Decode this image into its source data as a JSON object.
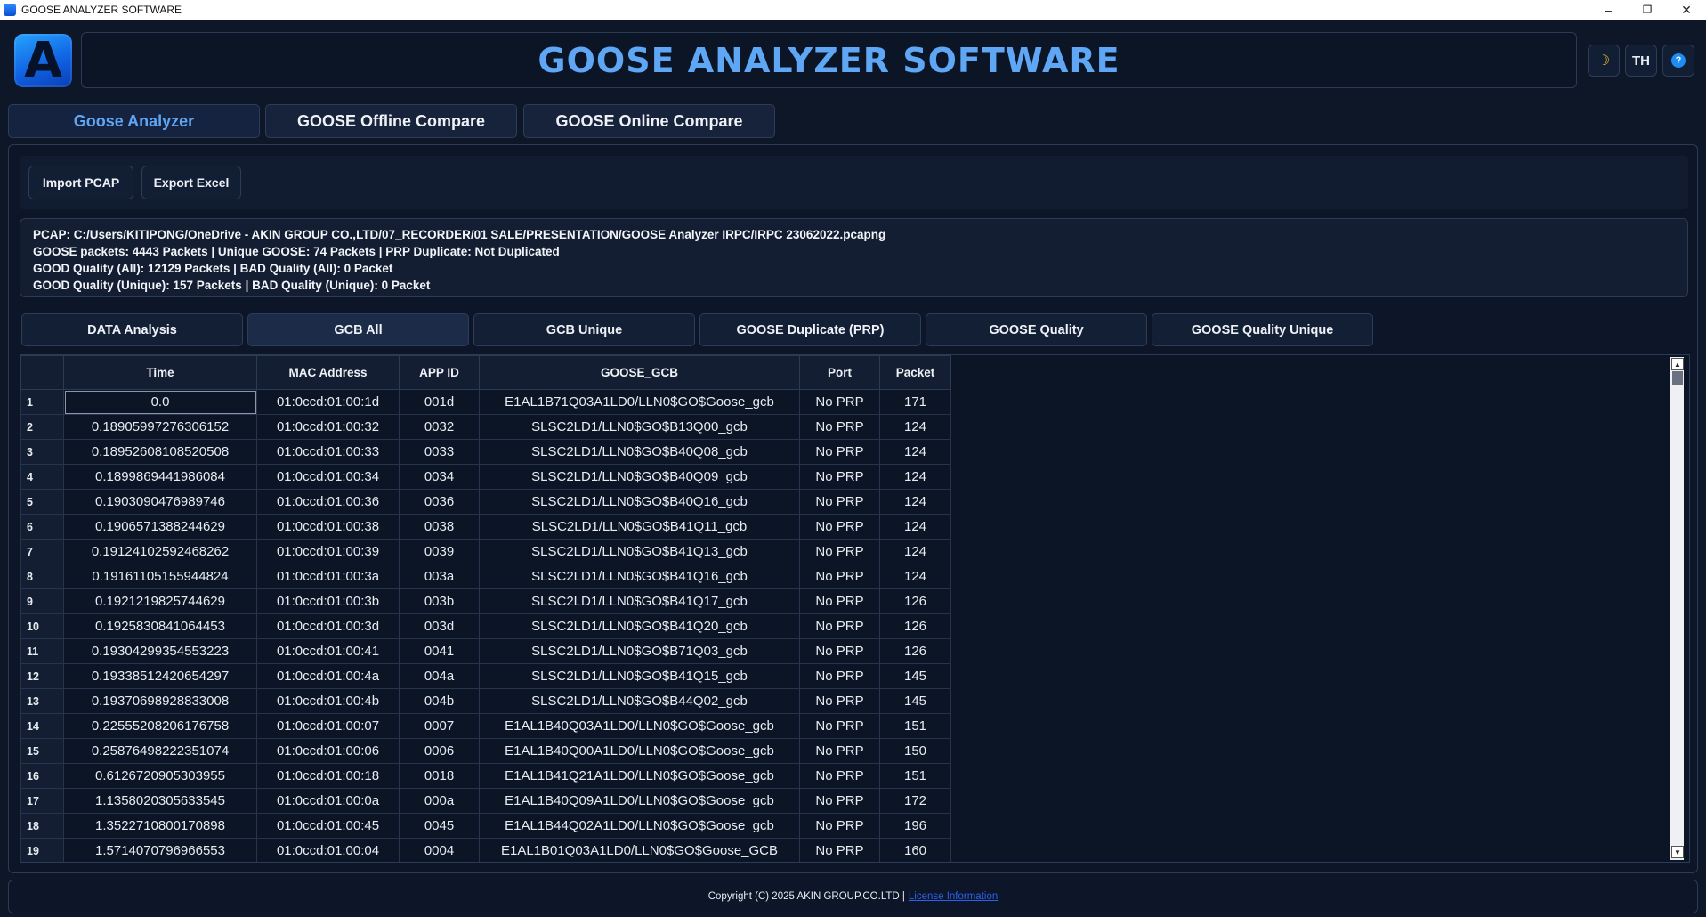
{
  "window": {
    "title": "GOOSE ANALYZER SOFTWARE",
    "minimize": "–",
    "restore": "❐",
    "close": "✕"
  },
  "header": {
    "logo_letter": "A",
    "title": "GOOSE ANALYZER SOFTWARE",
    "theme_icon": "☽",
    "lang_label": "TH",
    "help_icon": "?"
  },
  "main_tabs": [
    {
      "label": "Goose Analyzer"
    },
    {
      "label": "GOOSE Offline Compare"
    },
    {
      "label": "GOOSE Online Compare"
    }
  ],
  "toolbar": {
    "import_label": "Import PCAP",
    "export_label": "Export Excel"
  },
  "info": {
    "line1": "PCAP: C:/Users/KITIPONG/OneDrive - AKIN GROUP CO.,LTD/07_RECORDER/01 SALE/PRESENTATION/GOOSE Analyzer IRPC/IRPC 23062022.pcapng",
    "line2": "GOOSE packets: 4443 Packets | Unique GOOSE: 74 Packets | PRP Duplicate: Not Duplicated",
    "line3": "GOOD Quality (All): 12129 Packets | BAD Quality (All): 0 Packet",
    "line4": "GOOD Quality (Unique): 157 Packets | BAD Quality (Unique): 0 Packet"
  },
  "sub_tabs": [
    {
      "label": "DATA Analysis"
    },
    {
      "label": "GCB All"
    },
    {
      "label": "GCB Unique"
    },
    {
      "label": "GOOSE Duplicate (PRP)"
    },
    {
      "label": "GOOSE Quality"
    },
    {
      "label": "GOOSE Quality Unique"
    }
  ],
  "table": {
    "columns": [
      "Time",
      "MAC Address",
      "APP ID",
      "GOOSE_GCB",
      "Port",
      "Packet"
    ],
    "rows": [
      [
        "1",
        "0.0",
        "01:0ccd:01:00:1d",
        "001d",
        "E1AL1B71Q03A1LD0/LLN0$GO$Goose_gcb",
        "No PRP",
        "171"
      ],
      [
        "2",
        "0.18905997276306152",
        "01:0ccd:01:00:32",
        "0032",
        "SLSC2LD1/LLN0$GO$B13Q00_gcb",
        "No PRP",
        "124"
      ],
      [
        "3",
        "0.18952608108520508",
        "01:0ccd:01:00:33",
        "0033",
        "SLSC2LD1/LLN0$GO$B40Q08_gcb",
        "No PRP",
        "124"
      ],
      [
        "4",
        "0.1899869441986084",
        "01:0ccd:01:00:34",
        "0034",
        "SLSC2LD1/LLN0$GO$B40Q09_gcb",
        "No PRP",
        "124"
      ],
      [
        "5",
        "0.1903090476989746",
        "01:0ccd:01:00:36",
        "0036",
        "SLSC2LD1/LLN0$GO$B40Q16_gcb",
        "No PRP",
        "124"
      ],
      [
        "6",
        "0.1906571388244629",
        "01:0ccd:01:00:38",
        "0038",
        "SLSC2LD1/LLN0$GO$B41Q11_gcb",
        "No PRP",
        "124"
      ],
      [
        "7",
        "0.19124102592468262",
        "01:0ccd:01:00:39",
        "0039",
        "SLSC2LD1/LLN0$GO$B41Q13_gcb",
        "No PRP",
        "124"
      ],
      [
        "8",
        "0.19161105155944824",
        "01:0ccd:01:00:3a",
        "003a",
        "SLSC2LD1/LLN0$GO$B41Q16_gcb",
        "No PRP",
        "124"
      ],
      [
        "9",
        "0.1921219825744629",
        "01:0ccd:01:00:3b",
        "003b",
        "SLSC2LD1/LLN0$GO$B41Q17_gcb",
        "No PRP",
        "126"
      ],
      [
        "10",
        "0.1925830841064453",
        "01:0ccd:01:00:3d",
        "003d",
        "SLSC2LD1/LLN0$GO$B41Q20_gcb",
        "No PRP",
        "126"
      ],
      [
        "11",
        "0.19304299354553223",
        "01:0ccd:01:00:41",
        "0041",
        "SLSC2LD1/LLN0$GO$B71Q03_gcb",
        "No PRP",
        "126"
      ],
      [
        "12",
        "0.19338512420654297",
        "01:0ccd:01:00:4a",
        "004a",
        "SLSC2LD1/LLN0$GO$B41Q15_gcb",
        "No PRP",
        "145"
      ],
      [
        "13",
        "0.19370698928833008",
        "01:0ccd:01:00:4b",
        "004b",
        "SLSC2LD1/LLN0$GO$B44Q02_gcb",
        "No PRP",
        "145"
      ],
      [
        "14",
        "0.22555208206176758",
        "01:0ccd:01:00:07",
        "0007",
        "E1AL1B40Q03A1LD0/LLN0$GO$Goose_gcb",
        "No PRP",
        "151"
      ],
      [
        "15",
        "0.25876498222351074",
        "01:0ccd:01:00:06",
        "0006",
        "E1AL1B40Q00A1LD0/LLN0$GO$Goose_gcb",
        "No PRP",
        "150"
      ],
      [
        "16",
        "0.6126720905303955",
        "01:0ccd:01:00:18",
        "0018",
        "E1AL1B41Q21A1LD0/LLN0$GO$Goose_gcb",
        "No PRP",
        "151"
      ],
      [
        "17",
        "1.1358020305633545",
        "01:0ccd:01:00:0a",
        "000a",
        "E1AL1B40Q09A1LD0/LLN0$GO$Goose_gcb",
        "No PRP",
        "172"
      ],
      [
        "18",
        "1.3522710800170898",
        "01:0ccd:01:00:45",
        "0045",
        "E1AL1B44Q02A1LD0/LLN0$GO$Goose_gcb",
        "No PRP",
        "196"
      ],
      [
        "19",
        "1.5714070796966553",
        "01:0ccd:01:00:04",
        "0004",
        "E1AL1B01Q03A1LD0/LLN0$GO$Goose_GCB",
        "No PRP",
        "160"
      ]
    ]
  },
  "scrollbar": {
    "up": "▲",
    "down": "▼"
  },
  "footer": {
    "copyright": "Copyright (C) 2025 AKIN GROUP.CO.LTD |",
    "link": "License Information"
  },
  "colors": {
    "accent": "#5fa6f5",
    "background": "#0d1728",
    "link": "#2f5ff0"
  }
}
